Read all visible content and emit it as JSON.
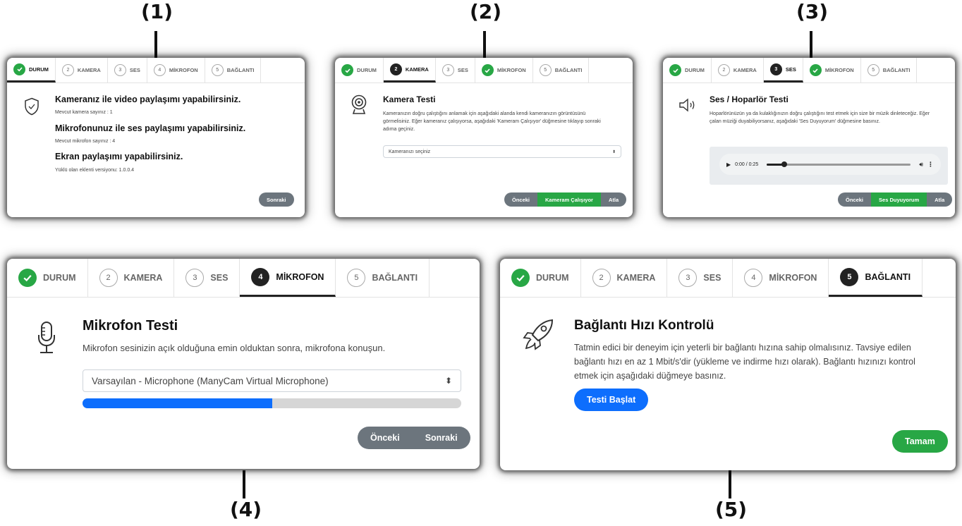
{
  "labels": {
    "p1": "(1)",
    "p2": "(2)",
    "p3": "(3)",
    "p4": "(4)",
    "p5": "(5)"
  },
  "tabs": {
    "durum": "DURUM",
    "kamera": "KAMERA",
    "ses": "SES",
    "mikrofon": "MİKROFON",
    "baglanti": "BAĞLANTI",
    "n2": "2",
    "n3": "3",
    "n4": "4",
    "n5": "5"
  },
  "panel1": {
    "camera_heading": "Kameranız ile video paylaşımı yapabilirsiniz.",
    "camera_count": "Mevcut kamera sayınız : 1",
    "mic_heading": "Mikrofonunuz ile ses paylaşımı yapabilirsiniz.",
    "mic_count": "Mevcut mikrofon sayınız : 4",
    "screen_heading": "Ekran paylaşımı yapabilirsiniz.",
    "extension_version": "Yüklü olan eklenti versiyonu: 1.0.0.4",
    "next_button": "Sonraki"
  },
  "panel2": {
    "title": "Kamera Testi",
    "description": "Kameranızın doğru çalıştığını anlamak için aşağıdaki alanda kendi kameranızın görüntüsünü görmelisiniz. Eğer kameranız çalışıyorsa, aşağıdaki 'Kameram Çalışıyor' düğmesine tıklayıp sonraki adıma geçiniz.",
    "camera_select": "Kameranızı seçiniz",
    "prev_button": "Önceki",
    "confirm_button": "Kameram Çalışıyor",
    "skip_button": "Atla"
  },
  "panel3": {
    "title": "Ses / Hoparlör Testi",
    "description": "Hoparlörünüzün ya da kulaklığınızın doğru çalıştığını test etmek için size bir müzik dinleteceğiz. Eğer çalan müziği duyabiliyorsanız, aşağıdaki 'Ses Duyuyorum' düğmesine basınız.",
    "audio_time": "0:00 / 0:25",
    "audio_progress": 0.12,
    "prev_button": "Önceki",
    "confirm_button": "Ses Duyuyorum",
    "skip_button": "Atla"
  },
  "panel4": {
    "title": "Mikrofon Testi",
    "description": "Mikrofon sesinizin açık olduğuna emin olduktan sonra, mikrofona konuşun.",
    "mic_select": "Varsayılan - Microphone (ManyCam Virtual Microphone)",
    "mic_level": 0.5,
    "prev_button": "Önceki",
    "next_button": "Sonraki"
  },
  "panel5": {
    "title": "Bağlantı Hızı Kontrolü",
    "description": "Tatmin edici bir deneyim için yeterli bir bağlantı hızına sahip olmalısınız. Tavsiye edilen bağlantı hızı en az 1 Mbit/s'dir (yükleme ve indirme hızı olarak). Bağlantı hızınızı kontrol etmek için aşağıdaki düğmeye basınız.",
    "start_test_button": "Testi Başlat",
    "done_button": "Tamam"
  },
  "colors": {
    "accent_green": "#28a745",
    "accent_blue": "#0d6efd",
    "button_gray": "#6c757d",
    "active_tab": "#222222"
  }
}
